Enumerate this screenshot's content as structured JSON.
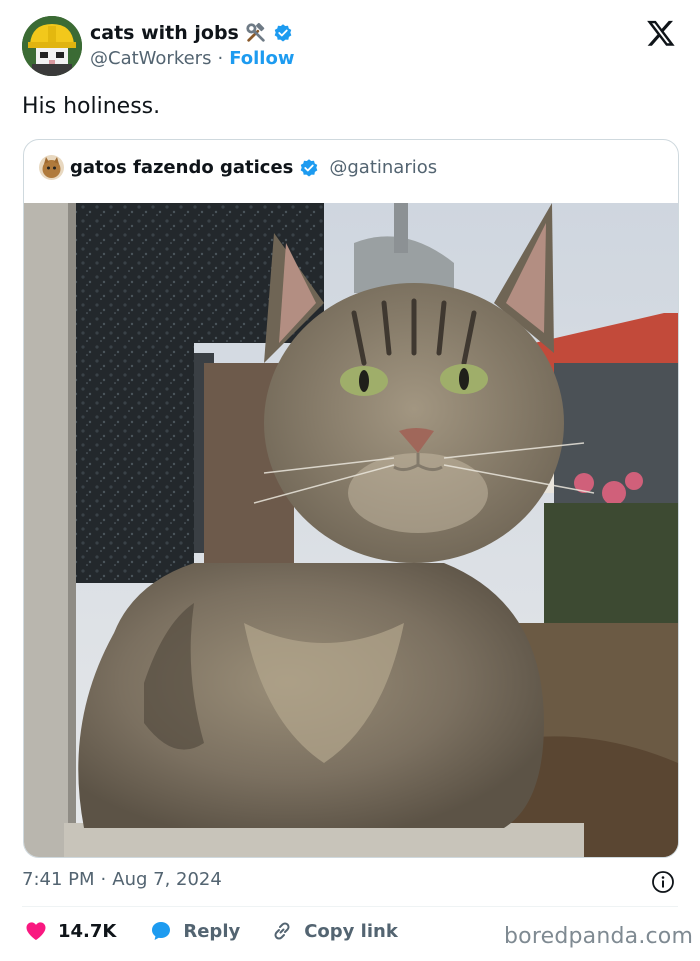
{
  "author": {
    "name": "cats with jobs",
    "handle": "@CatWorkers",
    "separator": "·",
    "follow_label": "Follow",
    "avatar_icon": "cat-hardhat-avatar-icon",
    "emoji_icon": "hammer-and-wrench-icon",
    "verified_color": "#1d9bf0"
  },
  "tweet": {
    "text": "His holiness."
  },
  "quote": {
    "name": "gatos fazendo gatices",
    "handle": "@gatinarios",
    "avatar_icon": "cat-avatar-icon"
  },
  "meta": {
    "time": "7:41 PM",
    "separator": "·",
    "date": "Aug 7, 2024"
  },
  "actions": {
    "like_count": "14.7K",
    "reply_label": "Reply",
    "copy_label": "Copy link",
    "like_color": "#f91880",
    "reply_color": "#1d9bf0"
  },
  "watermark": "boredpanda.com"
}
